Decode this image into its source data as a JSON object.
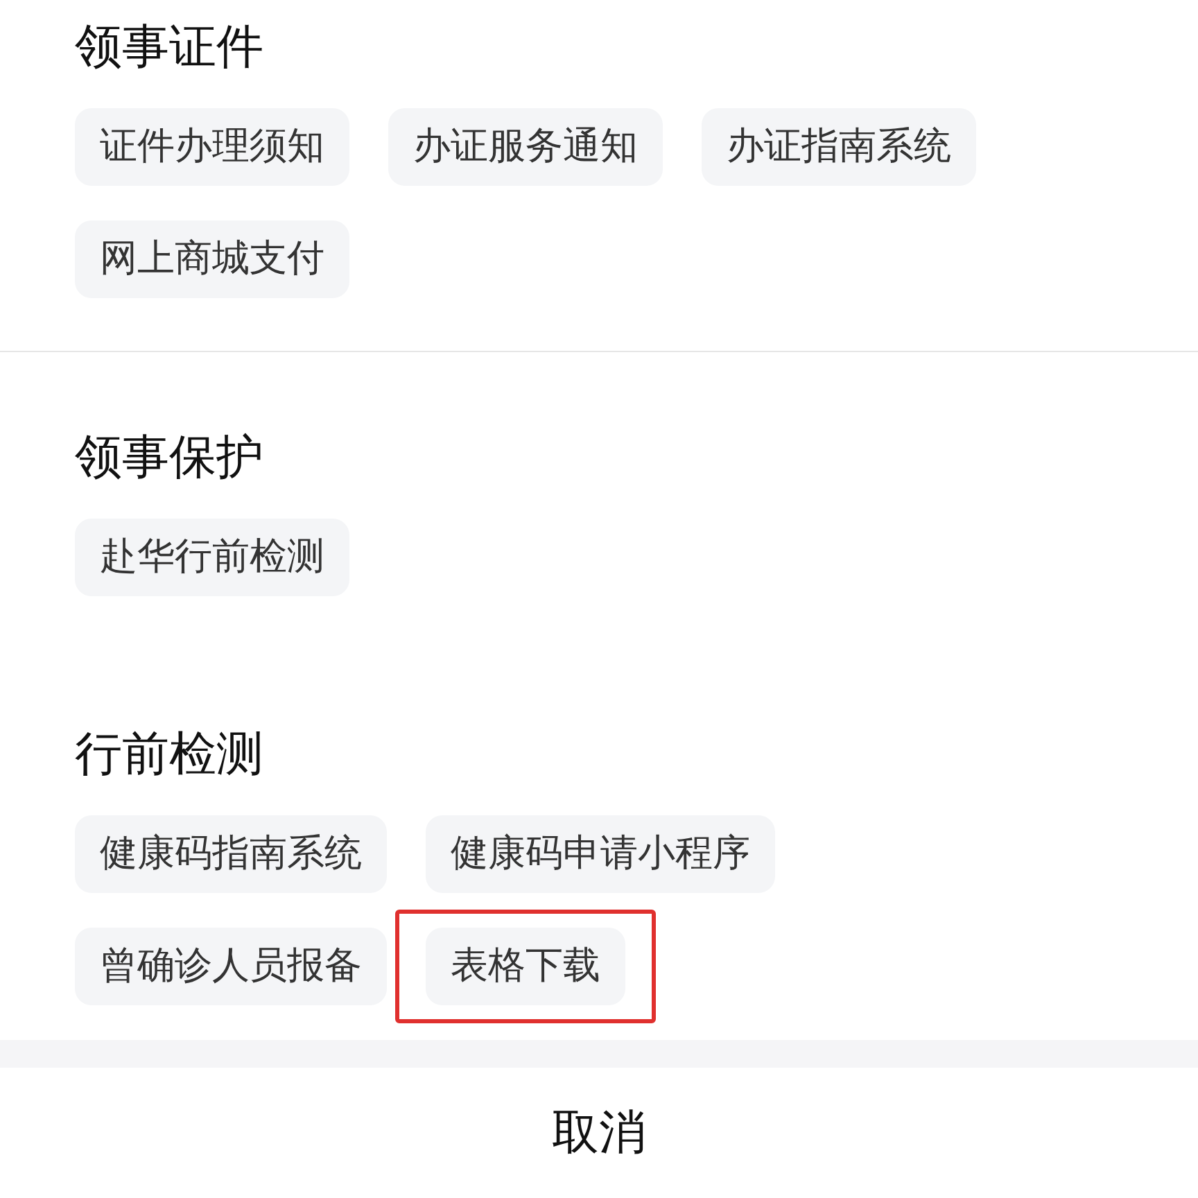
{
  "sections": [
    {
      "title": "领事证件",
      "divider_after": true,
      "items": [
        {
          "label": "证件办理须知",
          "highlighted": false
        },
        {
          "label": "办证服务通知",
          "highlighted": false
        },
        {
          "label": "办证指南系统",
          "highlighted": false
        },
        {
          "label": "网上商城支付",
          "highlighted": false
        }
      ]
    },
    {
      "title": "领事保护",
      "divider_after": false,
      "items": [
        {
          "label": "赴华行前检测",
          "highlighted": false
        }
      ]
    },
    {
      "title": "行前检测",
      "divider_after": false,
      "items": [
        {
          "label": "健康码指南系统",
          "highlighted": false
        },
        {
          "label": "健康码申请小程序",
          "highlighted": false
        },
        {
          "label": "曾确诊人员报备",
          "highlighted": false
        },
        {
          "label": "表格下载",
          "highlighted": true
        }
      ]
    }
  ],
  "cancel_button": "取消"
}
